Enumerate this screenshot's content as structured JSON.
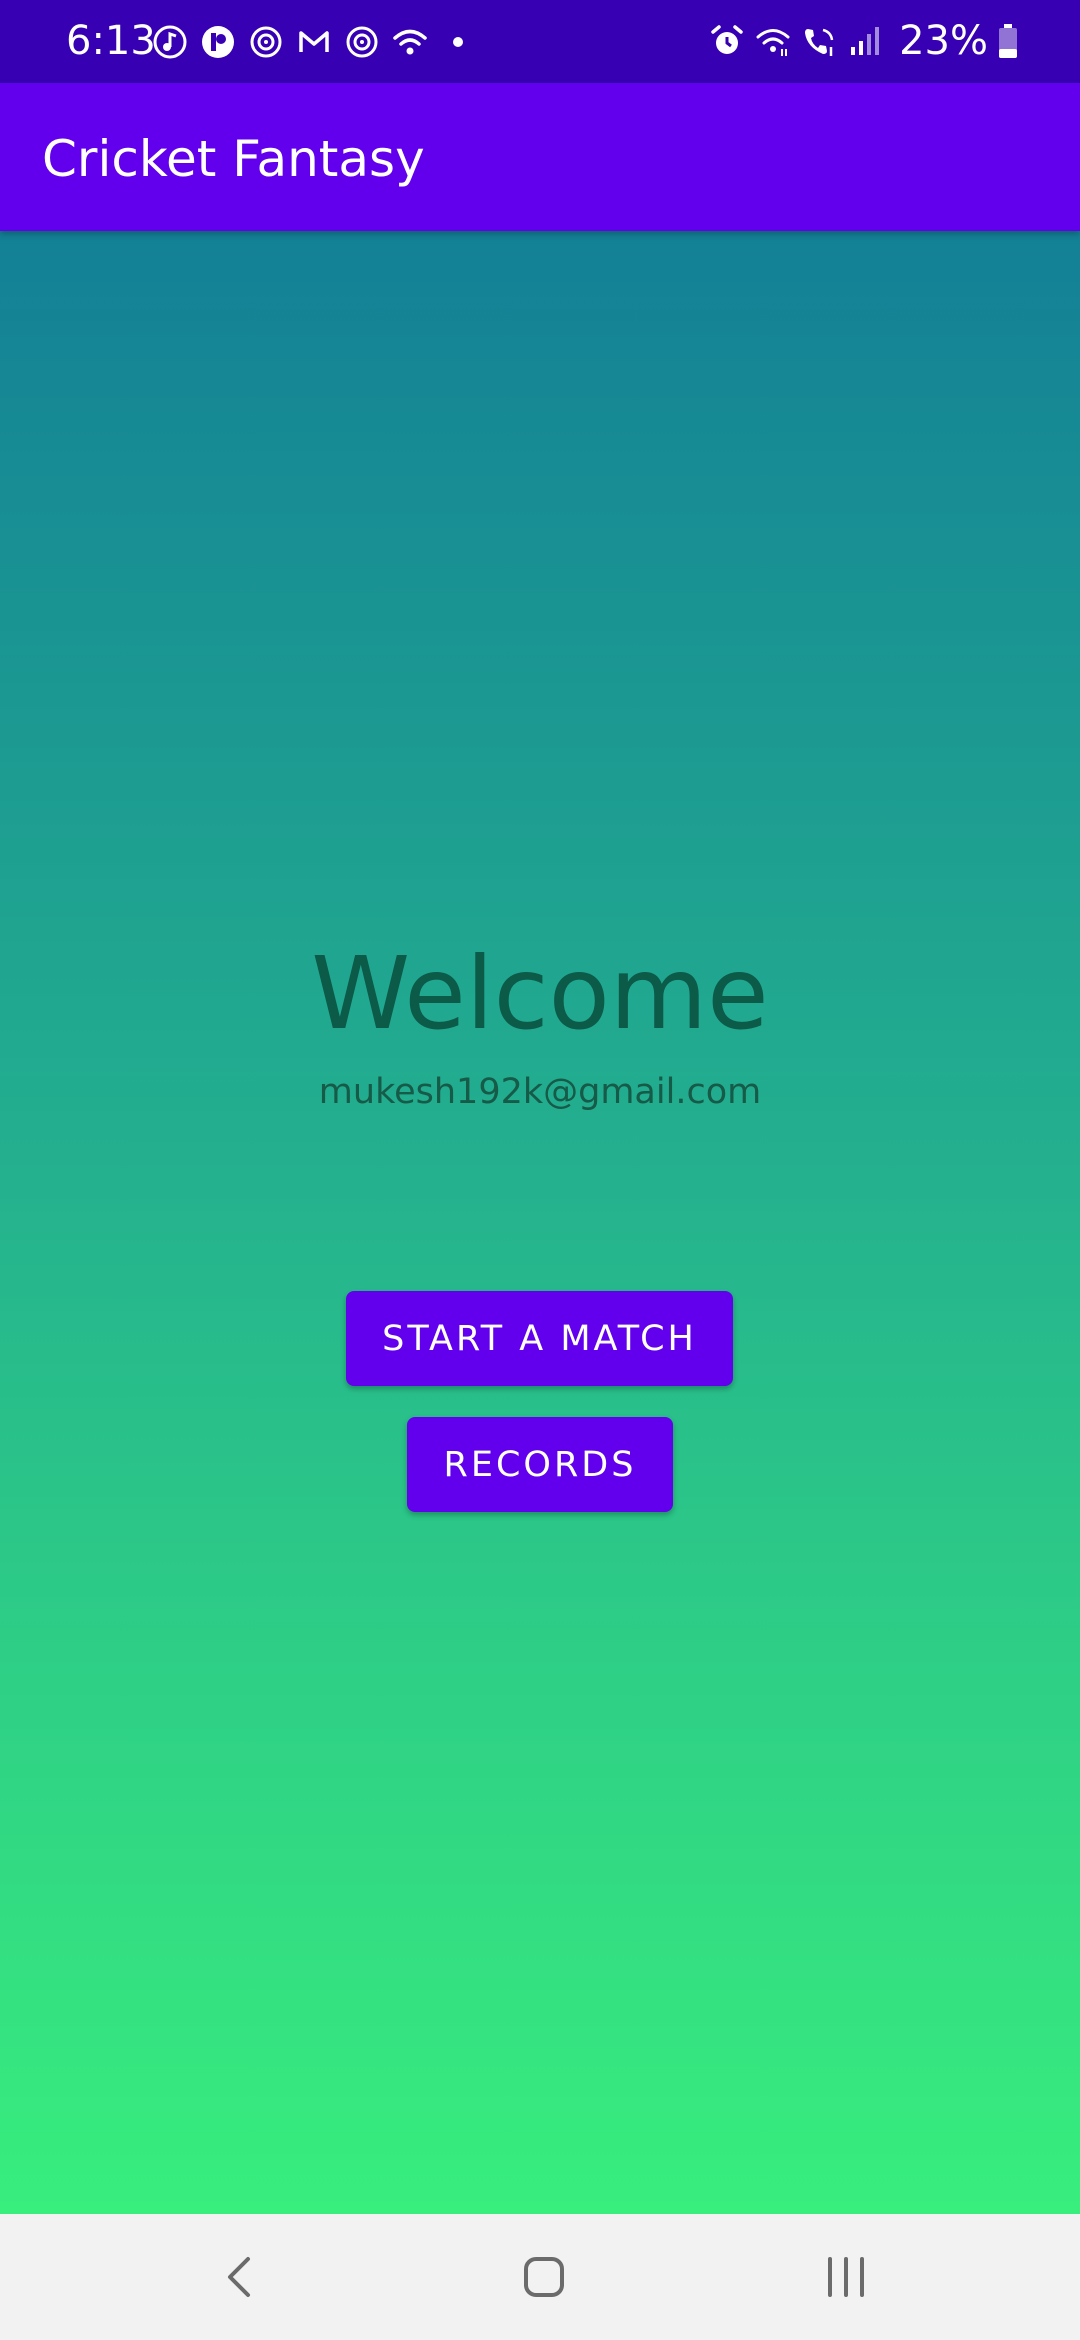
{
  "status_bar": {
    "time": "6:13",
    "battery_percent": "23%",
    "left_icons": [
      "music-note-icon",
      "app-notification-icon",
      "sync-icon",
      "gmail-icon",
      "sync-icon",
      "wifi-icon",
      "dot-icon"
    ],
    "right_icons": [
      "alarm-icon",
      "wifi-calling-icon",
      "volte-call-icon",
      "signal-icon",
      "battery-icon"
    ],
    "colors": {
      "background": "#3700b3",
      "foreground": "#ffffff"
    }
  },
  "app_bar": {
    "title": "Cricket Fantasy",
    "color": "#6200ee"
  },
  "main": {
    "welcome": "Welcome",
    "email": "mukesh192k@gmail.com",
    "buttons": {
      "start_match": "START A MATCH",
      "records": "RECORDS"
    },
    "gradient": {
      "top": "#138096",
      "bottom": "#38ee7d"
    },
    "accent": "#6200ee"
  },
  "nav_bar": {
    "items": [
      "back-icon",
      "home-icon",
      "recents-icon"
    ]
  }
}
